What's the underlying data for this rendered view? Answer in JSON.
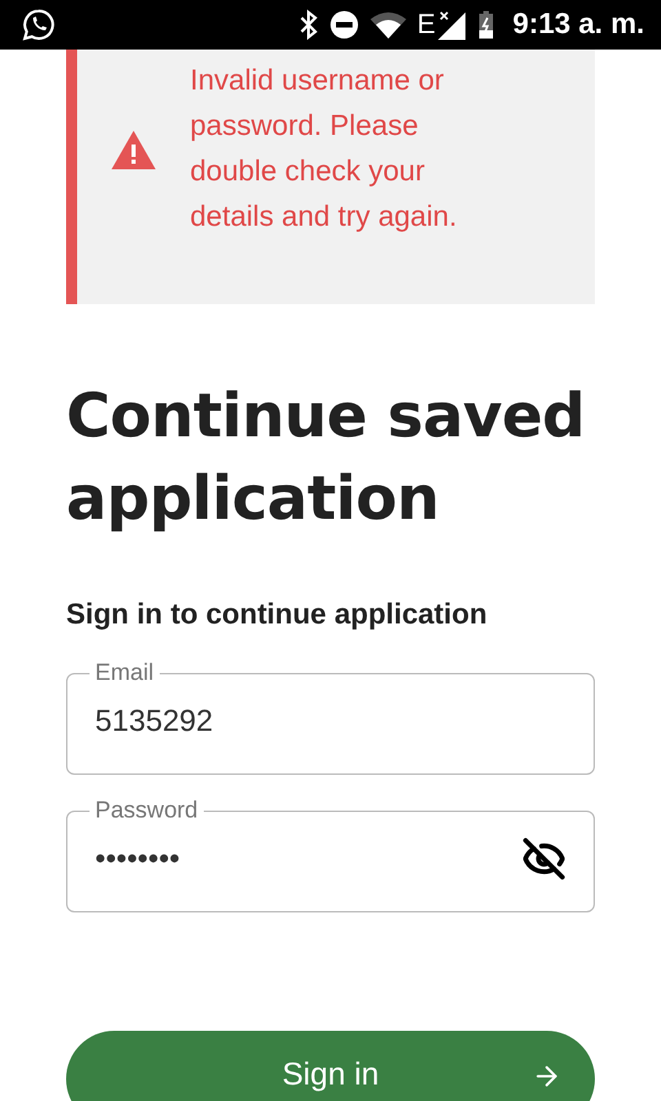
{
  "status_bar": {
    "network_type": "E",
    "time": "9:13 a. m."
  },
  "alert": {
    "message": "Invalid username or password. Please double check your details and try again."
  },
  "heading": "Continue saved application",
  "subheading": "Sign in to continue application",
  "fields": [
    {
      "kind": "text",
      "label": "Email",
      "value": "5135292"
    },
    {
      "kind": "password",
      "label": "Password",
      "value": "••••••••"
    }
  ],
  "submit": {
    "label": "Sign in"
  }
}
